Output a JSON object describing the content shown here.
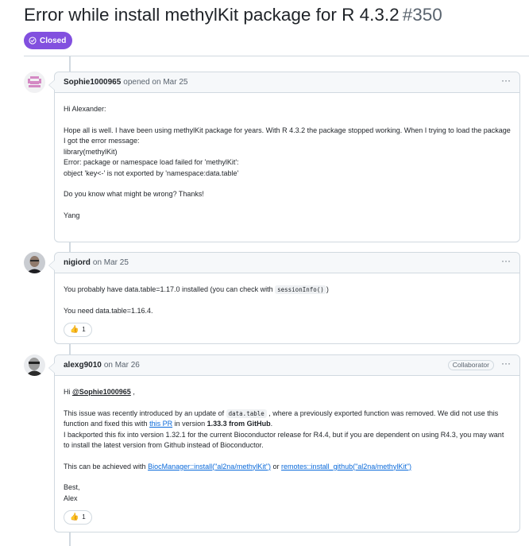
{
  "issue": {
    "title": "Error while install methylKit package for R 4.3.2",
    "number": "#350",
    "state": "Closed",
    "state_color": "#8250df"
  },
  "comments": [
    {
      "author": "Sophie1000965",
      "action": "opened on Mar 25",
      "menu": "···",
      "body": {
        "greeting": "Hi Alexander:",
        "para1": "Hope all is well. I have been using methylKit package for years. With R 4.3.2 the package stopped working. When I trying to load the package I got the error message:",
        "line1": "library(methylKit)",
        "line2": "Error: package or namespace load failed for 'methylKit':",
        "line3": "object 'key<-' is not exported by 'namespace:data.table'",
        "question": "Do you know what might be wrong? Thanks!",
        "signoff": "Yang"
      }
    },
    {
      "author": "nigiord",
      "action": "on Mar 25",
      "menu": "···",
      "body": {
        "p1_a": "You probably have data.table=1.17.0 installed (you can check with ",
        "p1_code": "sessionInfo()",
        "p1_b": ")",
        "p2": "You need data.table=1.16.4."
      },
      "reaction": {
        "emoji": "👍",
        "count": "1"
      }
    },
    {
      "author": "alexg9010",
      "action": "on Mar 26",
      "role": "Collaborator",
      "menu": "···",
      "body": {
        "hi": "Hi ",
        "mention": "@Sophie1000965",
        "hi_end": " ,",
        "p1_a": "This issue was recently introduced by an update of ",
        "p1_code": "data.table",
        "p1_b": " , where a previously exported function was removed. We did not use this function and fixed this with ",
        "p1_link": "this PR",
        "p1_c": " in version ",
        "p1_bold": "1.33.3 from GitHub",
        "p1_d": ".",
        "p2": "I backported this fix into version 1.32.1 for the current Bioconductor release for R4.4, but if you are dependent on using R4.3, you may want to install the latest version from Github instead of Bioconductor.",
        "p3_a": "This can be achieved with ",
        "p3_link1": " BiocManager::install(\"al2na/methylKit\")",
        "p3_b": " or ",
        "p3_link2": "remotes::install_github(\"al2na/methylKit\")",
        "best": "Best,",
        "name": "Alex"
      },
      "reaction": {
        "emoji": "👍",
        "count": "1"
      }
    }
  ]
}
